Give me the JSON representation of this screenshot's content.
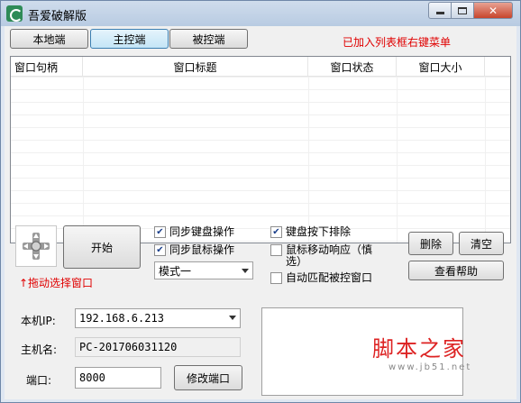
{
  "window": {
    "title": "吾爱破解版",
    "icon": "app-logo-icon"
  },
  "tabs": [
    {
      "label": "本地端",
      "active": false
    },
    {
      "label": "主控端",
      "active": true
    },
    {
      "label": "被控端",
      "active": false
    }
  ],
  "hint": "已加入列表框右键菜单",
  "table": {
    "columns": [
      "窗口句柄",
      "窗口标题",
      "窗口状态",
      "窗口大小"
    ],
    "rows": []
  },
  "controls": {
    "start_label": "开始",
    "drag_hint": "↑拖动选择窗口",
    "sync_keyboard": {
      "label": "同步键盘操作",
      "checked": true
    },
    "sync_mouse": {
      "label": "同步鼠标操作",
      "checked": true
    },
    "mode_select": "模式一",
    "keyboard_exclude": {
      "label": "键盘按下排除",
      "checked": true
    },
    "mouse_move": {
      "label": "鼠标移动响应（慎选）",
      "checked": false
    },
    "auto_match": {
      "label": "自动匹配被控窗口",
      "checked": false
    },
    "delete_label": "删除",
    "clear_label": "清空",
    "help_label": "查看帮助"
  },
  "network": {
    "ip_label": "本机IP:",
    "ip_value": "192.168.6.213",
    "host_label": "主机名:",
    "host_value": "PC-201706031120",
    "port_label": "端口:",
    "port_value": "8000",
    "modify_port_label": "修改端口"
  },
  "watermark": {
    "big": "脚本之家",
    "small": "www.jb51.net"
  },
  "colors": {
    "hint_red": "#e00000",
    "titlebar": "#c4d4e8"
  }
}
